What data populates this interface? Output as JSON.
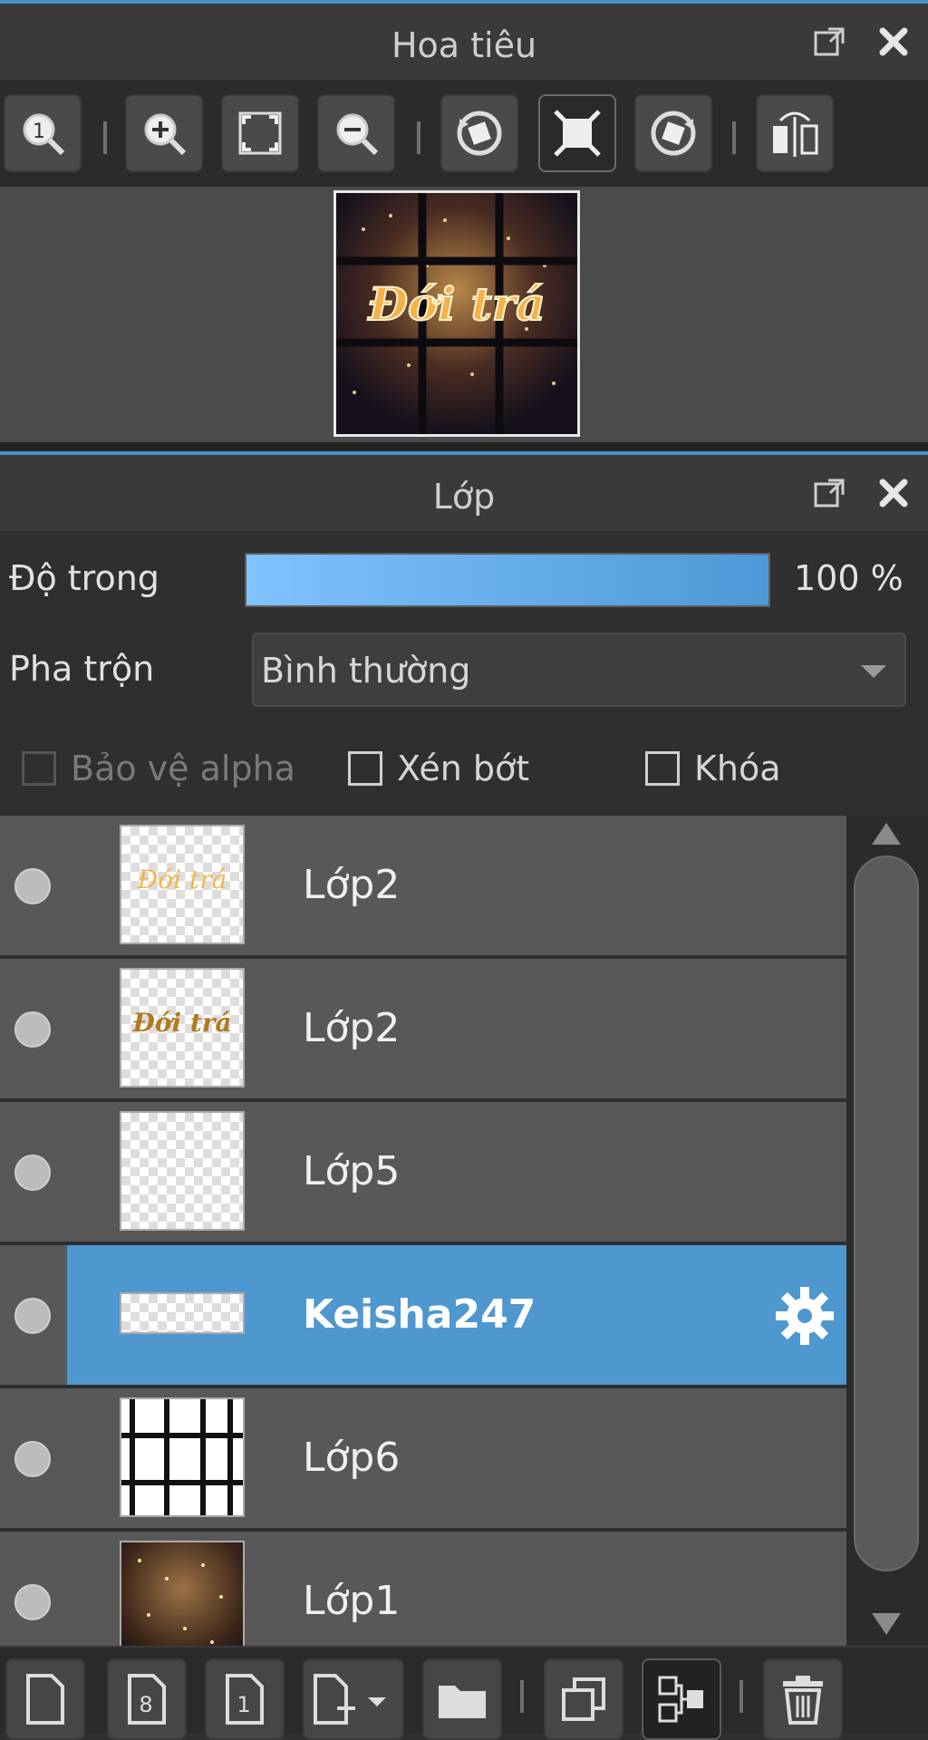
{
  "navigator": {
    "title": "Hoa tiêu",
    "toolbar": [
      {
        "name": "zoom-actual-button",
        "icon": "zoom-actual-icon"
      },
      {
        "name": "zoom-in-button",
        "icon": "zoom-in-icon"
      },
      {
        "name": "fit-screen-button",
        "icon": "fit-screen-icon"
      },
      {
        "name": "zoom-out-button",
        "icon": "zoom-out-icon"
      },
      {
        "name": "rotate-left-button",
        "icon": "rotate-left-icon"
      },
      {
        "name": "reset-rotation-button",
        "icon": "reset-rotation-icon"
      },
      {
        "name": "rotate-right-button",
        "icon": "rotate-right-icon"
      },
      {
        "name": "flip-horizontal-button",
        "icon": "flip-icon"
      }
    ],
    "preview_text": "Đới trá"
  },
  "layers_panel": {
    "title": "Lớp",
    "opacity_label": "Độ trong",
    "opacity_value": "100 %",
    "opacity_fraction": 1.0,
    "blend_label": "Pha trộn",
    "blend_value": "Bình thường",
    "checkboxes": {
      "alpha_protect": "Bảo vệ alpha",
      "clipping": "Xén bớt",
      "lock": "Khóa"
    },
    "layers": [
      {
        "name": "Lớp2",
        "selected": false
      },
      {
        "name": "Lớp2",
        "selected": false
      },
      {
        "name": "Lớp5",
        "selected": false
      },
      {
        "name": "Keisha247",
        "selected": true
      },
      {
        "name": "Lớp6",
        "selected": false
      },
      {
        "name": "Lớp1",
        "selected": false
      }
    ],
    "thumb_texts": {
      "layer1": "Đới trá",
      "layer2": "Đới trá"
    }
  },
  "colors": {
    "accent": "#4a90c8",
    "selected_row": "#4f97cf",
    "row": "#585858"
  },
  "bottom_toolbar": [
    {
      "name": "new-layer-button",
      "icon": "new-page-icon"
    },
    {
      "name": "new-8bit-layer-button",
      "icon": "layer-8-icon",
      "label": "8"
    },
    {
      "name": "new-1bit-layer-button",
      "icon": "layer-1-icon",
      "label": "1"
    },
    {
      "name": "add-layer-menu-button",
      "icon": "add-layer-dropdown-icon"
    },
    {
      "name": "new-folder-button",
      "icon": "folder-icon"
    },
    {
      "name": "duplicate-layer-button",
      "icon": "duplicate-icon"
    },
    {
      "name": "merge-down-button",
      "icon": "merge-icon"
    },
    {
      "name": "delete-layer-button",
      "icon": "trash-icon"
    }
  ]
}
